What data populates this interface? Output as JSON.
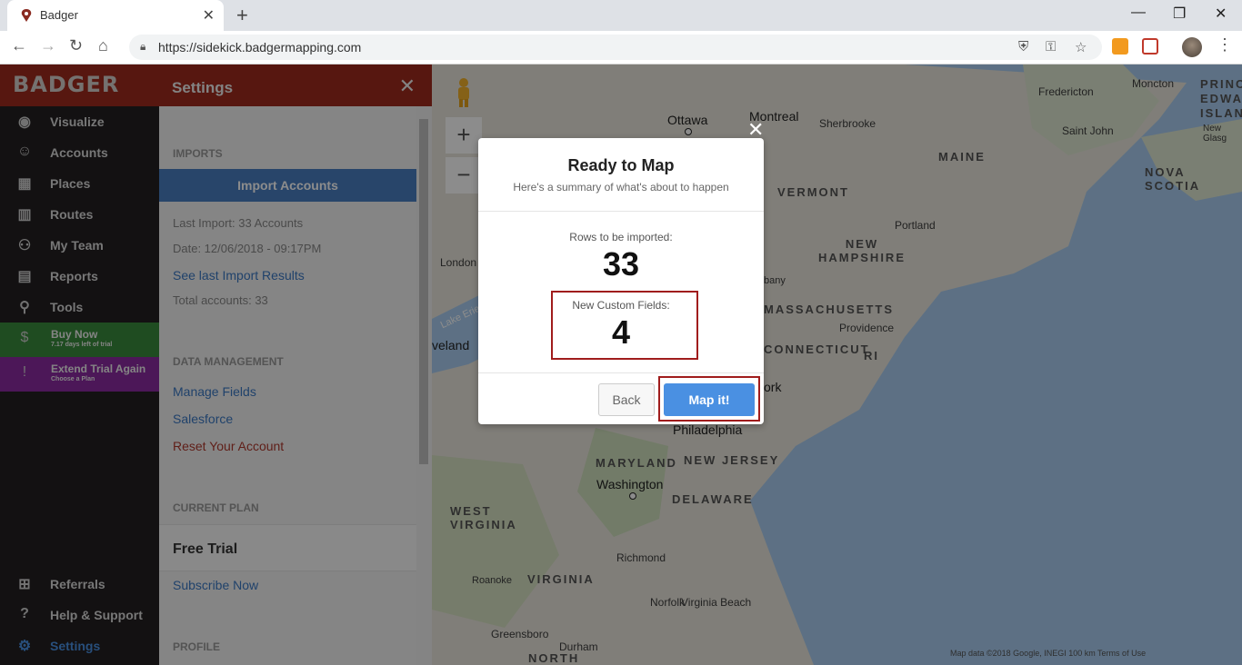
{
  "browser": {
    "tab_title": "Badger",
    "url": "https://sidekick.badgermapping.com"
  },
  "sidebar": {
    "logo": "BADGER",
    "items": [
      {
        "label": "Visualize",
        "icon": "eye-icon"
      },
      {
        "label": "Accounts",
        "icon": "person-icon"
      },
      {
        "label": "Places",
        "icon": "store-icon"
      },
      {
        "label": "Routes",
        "icon": "map-icon"
      },
      {
        "label": "My Team",
        "icon": "team-icon"
      },
      {
        "label": "Reports",
        "icon": "chart-icon"
      },
      {
        "label": "Tools",
        "icon": "pin-icon"
      }
    ],
    "buy_now": {
      "title": "Buy Now",
      "sub": "7.17 days left of trial"
    },
    "extend_trial": {
      "title": "Extend Trial Again",
      "sub": "Choose a Plan"
    },
    "referrals": "Referrals",
    "help": "Help & Support",
    "settings": "Settings"
  },
  "settings_panel": {
    "title": "Settings",
    "imports_label": "IMPORTS",
    "import_button": "Import Accounts",
    "last_import": "Last Import: 33 Accounts",
    "date": "Date: 12/06/2018 - 09:17PM",
    "see_results": "See last Import Results",
    "total_accounts": "Total accounts: 33",
    "data_mgmt_label": "DATA MANAGEMENT",
    "manage_fields": "Manage Fields",
    "salesforce": "Salesforce",
    "reset": "Reset Your Account",
    "current_plan_label": "CURRENT PLAN",
    "plan_name": "Free Trial",
    "subscribe": "Subscribe Now",
    "profile_label": "PROFILE"
  },
  "map": {
    "labels": [
      "Ottawa",
      "Montreal",
      "Sherbrooke",
      "Fredericton",
      "Moncton",
      "Saint John",
      "New Glasg",
      "Portland",
      "Providence",
      "London",
      "Philadelphia",
      "Washington",
      "Richmond",
      "Norfolk",
      "Virginia Beach",
      "Roanoke",
      "Greensboro",
      "Durham",
      "bany",
      "ork",
      "veland",
      "Lake Erie"
    ],
    "states": [
      "VERMONT",
      "MAINE",
      "NEW HAMPSHIRE",
      "MASSACHUSETTS",
      "CONNECTICUT",
      "RI",
      "MARYLAND",
      "NEW JERSEY",
      "DELAWARE",
      "WEST VIRGINIA",
      "VIRGINIA",
      "NOVA SCOTIA",
      "PRINC EDWA ISLAN",
      "NORTH"
    ],
    "attribution": "Map data ©2018 Google, INEGI   100 km            Terms of Use"
  },
  "modal": {
    "title": "Ready to Map",
    "subtitle": "Here's a summary of what's about to happen",
    "rows_label": "Rows to be imported:",
    "rows_value": "33",
    "fields_label": "New Custom Fields:",
    "fields_value": "4",
    "back": "Back",
    "map_it": "Map it!"
  },
  "colors": {
    "brand": "#9e2a1e",
    "primary": "#4a90e2",
    "highlight": "#a01c1c"
  }
}
